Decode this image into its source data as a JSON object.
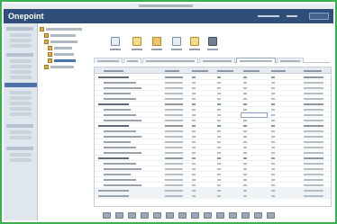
{
  "header": {
    "brand": "Onepoint"
  },
  "icons": {
    "toolbar": [
      "document-icon",
      "document-icon",
      "document-icon",
      "document-icon",
      "document-icon",
      "print-icon"
    ],
    "tree": [
      "folder-icon",
      "folder-icon",
      "folder-icon",
      "folder-icon",
      "folder-icon",
      "folder-icon",
      "folder-icon"
    ]
  },
  "colors": {
    "accent": "#37b24d",
    "header_background": "#2f4f7a",
    "selected": "#4d73a8",
    "folder": "#e0b040"
  }
}
